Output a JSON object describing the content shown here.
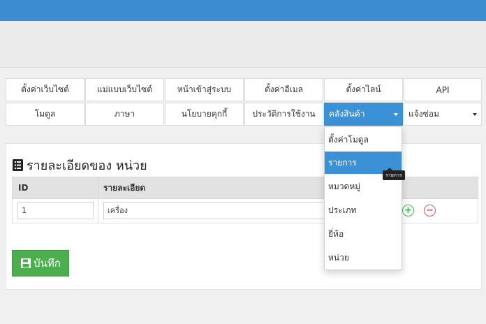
{
  "colors": {
    "primary": "#3a91d6",
    "success": "#4cae4c",
    "danger": "#d9534f",
    "add": "#3cb44a"
  },
  "nav": {
    "row1": [
      "ตั้งค่าเว็บไซต์",
      "แม่แบบเว็บไซต์",
      "หน้าเข้าสู่ระบบ",
      "ตั้งค่าอีเมล",
      "ตั้งค่าไลน์",
      "API"
    ],
    "row2": [
      "โมดูล",
      "ภาษา",
      "นโยบายคุกกี้",
      "ประวัติการใช้งาน",
      "คลังสินค้า",
      "แจ้งซ่อม"
    ]
  },
  "dropdown": {
    "items": [
      "ตั้งค่าโมดูล",
      "รายการ",
      "หมวดหมู่",
      "ประเภท",
      "ยี่ห้อ",
      "หน่วย"
    ],
    "hover_index": 1,
    "tooltip": "รายการ"
  },
  "panel": {
    "title": "รายละเอียดของ หน่วย",
    "columns": [
      "ID",
      "รายละเอียด"
    ],
    "row": {
      "id": "1",
      "detail": "เครื่อง"
    },
    "save_label": "บันทึก"
  }
}
